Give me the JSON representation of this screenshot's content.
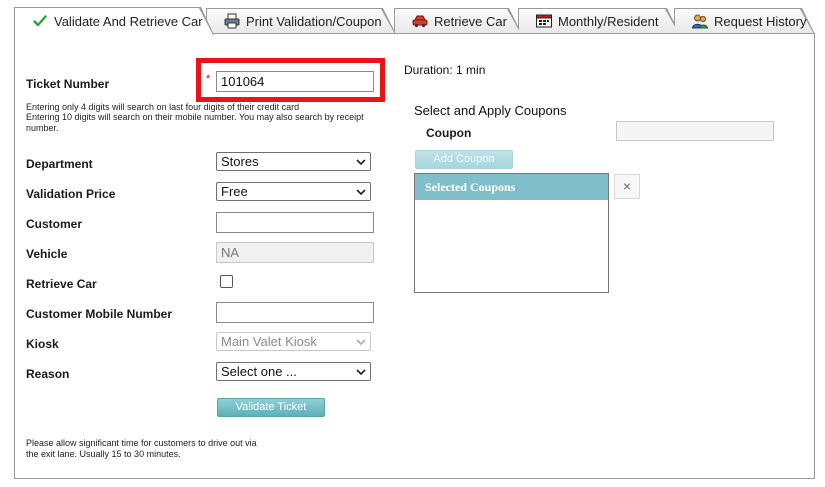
{
  "tabs": [
    {
      "label": "Validate And Retrieve Car",
      "icon": "checkmark-icon",
      "active": true
    },
    {
      "label": "Print Validation/Coupon",
      "icon": "printer-icon"
    },
    {
      "label": "Retrieve Car",
      "icon": "car-icon"
    },
    {
      "label": "Monthly/Resident",
      "icon": "calendar-icon"
    },
    {
      "label": "Request History",
      "icon": "users-icon"
    }
  ],
  "form": {
    "ticket_label": "Ticket Number",
    "required_mark": "*",
    "ticket_value": "101064",
    "help_line1": "Entering only 4 digits will search on last four digits of their credit card",
    "help_line2": "Entering 10 digits will search on their mobile number. You may also search by receipt",
    "help_line3": "number.",
    "department_label": "Department",
    "department_value": "Stores",
    "price_label": "Validation Price",
    "price_value": "Free",
    "customer_label": "Customer",
    "customer_value": "",
    "vehicle_label": "Vehicle",
    "vehicle_value": "NA",
    "retrieve_label": "Retrieve Car",
    "retrieve_checked": false,
    "mobile_label": "Customer Mobile Number",
    "mobile_value": "",
    "kiosk_label": "Kiosk",
    "kiosk_value": "Main Valet Kiosk",
    "reason_label": "Reason",
    "reason_value": "Select one ...",
    "validate_button": "Validate Ticket",
    "note_line1": "Please allow significant time for customers to drive out via",
    "note_line2": "the exit lane. Usually 15 to 30 minutes."
  },
  "coupons": {
    "duration": "Duration: 1 min",
    "section_title": "Select and Apply Coupons",
    "coupon_label": "Coupon",
    "coupon_value": "",
    "add_button": "Add Coupon",
    "selected_header": "Selected Coupons",
    "remove_symbol": "×"
  },
  "colors": {
    "highlight": "#e8141b",
    "accent": "#80bfca",
    "check": "#2e9e3e"
  }
}
